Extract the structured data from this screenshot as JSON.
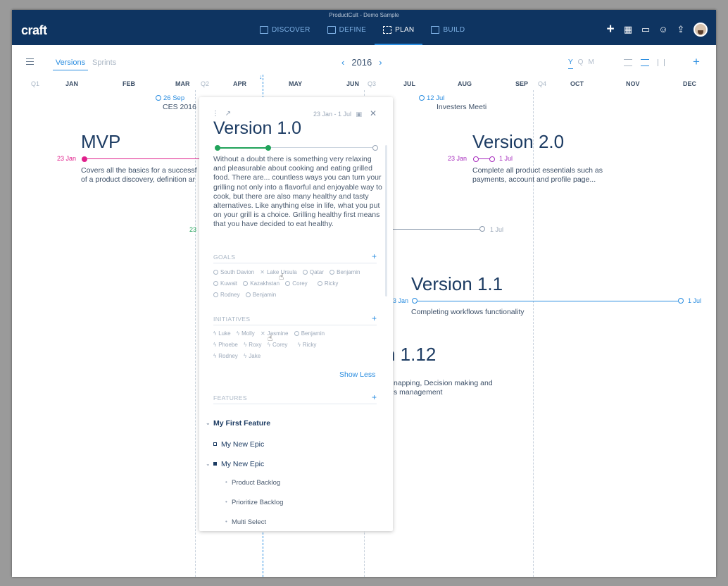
{
  "window_title": "ProductCult - Demo Sample",
  "logo": "craft",
  "nav": [
    "DISCOVER",
    "DEFINE",
    "PLAN",
    "BUILD"
  ],
  "nav_active": "PLAN",
  "header_icons": [
    "plus-icon",
    "grid-icon",
    "chat-icon",
    "people-icon",
    "share-icon",
    "user-avatar"
  ],
  "tabs": {
    "versions": "Versions",
    "sprints": "Sprints"
  },
  "year": "2016",
  "zoom": {
    "y": "Y",
    "q": "Q",
    "m": "M"
  },
  "months": {
    "q1": "Q1",
    "jan": "JAN",
    "feb": "FEB",
    "mar": "MAR",
    "q2": "Q2",
    "apr": "APR",
    "may": "MAY",
    "jun": "JUN",
    "q3": "Q3",
    "jul": "JUL",
    "aug": "AUG",
    "sep": "SEP",
    "q4": "Q4",
    "oct": "OCT",
    "nov": "NOV",
    "dec": "DEC"
  },
  "milestones": {
    "ces_date": "26 Sep",
    "ces_label": "CES 2016",
    "inv_date": "12 Jul",
    "inv_label": "Investers Meeti"
  },
  "roadmap": {
    "mvp_title": "MVP",
    "mvp_start": "23 Jan",
    "mvp_desc1": "Covers all the basics for a successf",
    "mvp_desc2": "of a product discovery, definition ar",
    "v2_title": "Version 2.0",
    "v2_start": "23 Jan",
    "v2_end": "1 Jul",
    "v2_desc1": "Complete all product essentials such as",
    "v2_desc2": "payments, account and profile page...",
    "mid_start": "23",
    "mid_end": "1 Jul",
    "v11_title": "Version 1.1",
    "v11_start": "3 Jan",
    "v11_end": "1 Jul",
    "v11_desc": "Completing workflows functionality",
    "v112_title": "n 1.12",
    "v112_desc1": "napping, Decision making and",
    "v112_desc2": "s management"
  },
  "card": {
    "date_range": "23 Jan - 1 Jul",
    "title": "Version 1.0",
    "description": "Without a doubt there is something very relaxing and pleasurable about cooking and eating grilled food. There are... countless ways you can turn your grilling not only into a flavorful and enjoyable way to cook, but there are also many healthy and tasty alternatives. Like anything else in life, what you put on your grill is a choice. Grilling healthy first means that you have decided to eat healthy.",
    "goals_header": "GOALS",
    "goals": [
      "South Davion",
      "Lake Ursula",
      "Qatar",
      "Benjamin",
      "Kuwait",
      "Kazakhstan",
      "Corey",
      "Ricky",
      "Rodney",
      "Benjamin"
    ],
    "initiatives_header": "INITIATIVES",
    "initiatives": [
      "Luke",
      "Molly",
      "Jasmine",
      "Benjamin",
      "Phoebe",
      "Roxy",
      "Corey",
      "Ricky",
      "Rodney",
      "Jake"
    ],
    "show_less": "Show Less",
    "features_header": "FEATURES",
    "feature": "My First Feature",
    "epic1": "My New Epic",
    "epic2": "My New Epic",
    "stories": [
      "Product Backlog",
      "Prioritize Backlog",
      "Multi Select"
    ]
  },
  "colors": {
    "nav_bg": "#0e3461",
    "accent": "#2a8de0",
    "mvp": "#e0208c",
    "v2": "#a62bbd",
    "progress": "#21a35a"
  }
}
